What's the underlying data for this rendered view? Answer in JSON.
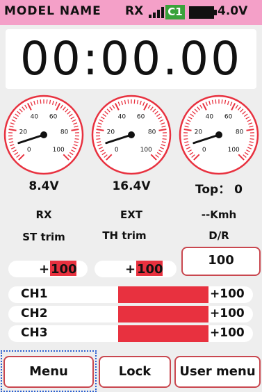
{
  "header": {
    "model_name": "MODEL NAME",
    "rx_label": "RX",
    "signal_icon": "signal-bars-icon",
    "channel_badge": "C1",
    "battery_icon": "battery-icon",
    "battery_voltage": "4.0V",
    "colors": {
      "bg": "#f4a0c8",
      "badge": "#3aa23a"
    }
  },
  "timer": {
    "value": "00:00.00"
  },
  "gauges": [
    {
      "ticks": [
        "0",
        "20",
        "40",
        "60",
        "80",
        "100"
      ],
      "value_text": "8.4V",
      "label": "RX"
    },
    {
      "ticks": [
        "0",
        "20",
        "40",
        "60",
        "80",
        "100"
      ],
      "value_text": "16.4V",
      "label": "EXT"
    },
    {
      "ticks": [
        "0",
        "20",
        "40",
        "60",
        "80",
        "100"
      ],
      "value_text": "Top： 0",
      "label": "--Kmh"
    }
  ],
  "trims": {
    "st_label": "ST trim",
    "st_sign": "+",
    "st_value": "100",
    "th_label": "TH trim",
    "th_sign": "+",
    "th_value": "100",
    "dr_label": "D/R",
    "dr_value": "100"
  },
  "channels": [
    {
      "name": "CH1",
      "value": "+100",
      "level": 1.0
    },
    {
      "name": "CH2",
      "value": "+100",
      "level": 1.0
    },
    {
      "name": "CH3",
      "value": "+100",
      "level": 1.0
    }
  ],
  "buttons": {
    "menu": "Menu",
    "lock": "Lock",
    "user_menu": "User menu"
  },
  "accent": "#e8313f"
}
